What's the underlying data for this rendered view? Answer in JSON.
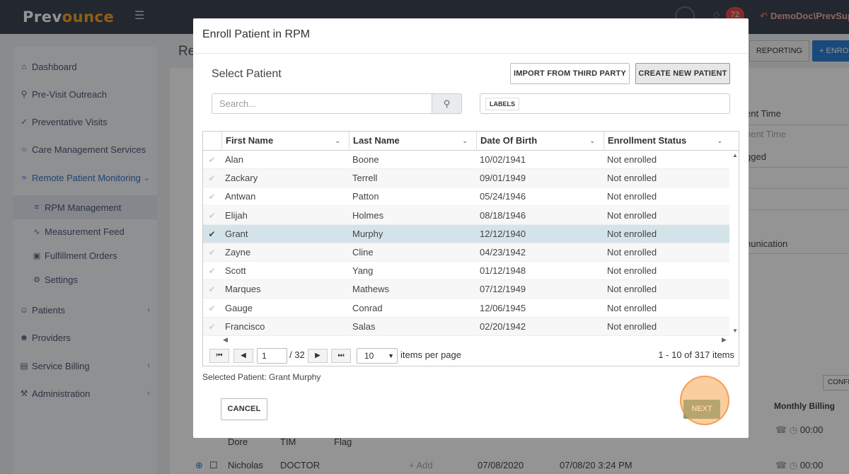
{
  "header": {
    "logo_main": "Prev",
    "logo_accent": "ounce",
    "notification_count": "72",
    "user": "DemoDoc\\PrevSup"
  },
  "sidebar": {
    "items": [
      {
        "label": "Dashboard",
        "icon": "home-icon"
      },
      {
        "label": "Pre-Visit Outreach",
        "icon": "people-search-icon"
      },
      {
        "label": "Preventative Visits",
        "icon": "check-circle-icon"
      },
      {
        "label": "Care Management Services",
        "icon": "chat-icon"
      },
      {
        "label": "Remote Patient Monitoring",
        "icon": "satellite-icon"
      },
      {
        "label": "Patients",
        "icon": "users-icon"
      },
      {
        "label": "Providers",
        "icon": "user-icon"
      },
      {
        "label": "Service Billing",
        "icon": "document-icon"
      },
      {
        "label": "Administration",
        "icon": "wrench-icon"
      }
    ],
    "rpm_sub": [
      {
        "label": "RPM Management",
        "icon": "list-icon"
      },
      {
        "label": "Measurement Feed",
        "icon": "feed-icon"
      },
      {
        "label": "Fulfillment Orders",
        "icon": "truck-icon"
      },
      {
        "label": "Settings",
        "icon": "gear-icon"
      }
    ]
  },
  "background": {
    "title": "Re",
    "reporting": "REPORTING",
    "enroll": "+ ENRO",
    "labels": [
      "ent Time",
      "nent Time",
      "gged",
      "nunication"
    ],
    "confirm": "CONFI",
    "monthly_billing": "Monthly Billing",
    "row1": {
      "first": "Dore",
      "last": "TIM",
      "flag": "Flag",
      "time": "00:00"
    },
    "row2": {
      "first": "Nicholas",
      "last": "DOCTOR",
      "add": "+ Add",
      "date": "07/08/2020",
      "datetime": "07/08/20 3:24 PM",
      "time": "00:00"
    }
  },
  "modal": {
    "title": "Enroll Patient in RPM",
    "section_title": "Select Patient",
    "import_button": "IMPORT FROM THIRD PARTY",
    "create_button": "CREATE NEW PATIENT",
    "search_placeholder": "Search...",
    "labels_chip": "LABELS",
    "columns": [
      "First Name",
      "Last Name",
      "Date Of Birth",
      "Enrollment Status"
    ],
    "rows": [
      {
        "first": "Alan",
        "last": "Boone",
        "dob": "10/02/1941",
        "status": "Not enrolled"
      },
      {
        "first": "Zackary",
        "last": "Terrell",
        "dob": "09/01/1949",
        "status": "Not enrolled"
      },
      {
        "first": "Antwan",
        "last": "Patton",
        "dob": "05/24/1946",
        "status": "Not enrolled"
      },
      {
        "first": "Elijah",
        "last": "Holmes",
        "dob": "08/18/1946",
        "status": "Not enrolled"
      },
      {
        "first": "Grant",
        "last": "Murphy",
        "dob": "12/12/1940",
        "status": "Not enrolled"
      },
      {
        "first": "Zayne",
        "last": "Cline",
        "dob": "04/23/1942",
        "status": "Not enrolled"
      },
      {
        "first": "Scott",
        "last": "Yang",
        "dob": "01/12/1948",
        "status": "Not enrolled"
      },
      {
        "first": "Marques",
        "last": "Mathews",
        "dob": "07/12/1949",
        "status": "Not enrolled"
      },
      {
        "first": "Gauge",
        "last": "Conrad",
        "dob": "12/06/1945",
        "status": "Not enrolled"
      },
      {
        "first": "Francisco",
        "last": "Salas",
        "dob": "02/20/1942",
        "status": "Not enrolled"
      }
    ],
    "selected_index": 4,
    "pager": {
      "current_page": "1",
      "total_pages": "/ 32",
      "per_page": "10",
      "per_page_label": "items per page",
      "count": "1 - 10 of 317 items"
    },
    "selected_patient": "Selected Patient: Grant Murphy",
    "cancel": "CANCEL",
    "next": "NEXT"
  }
}
